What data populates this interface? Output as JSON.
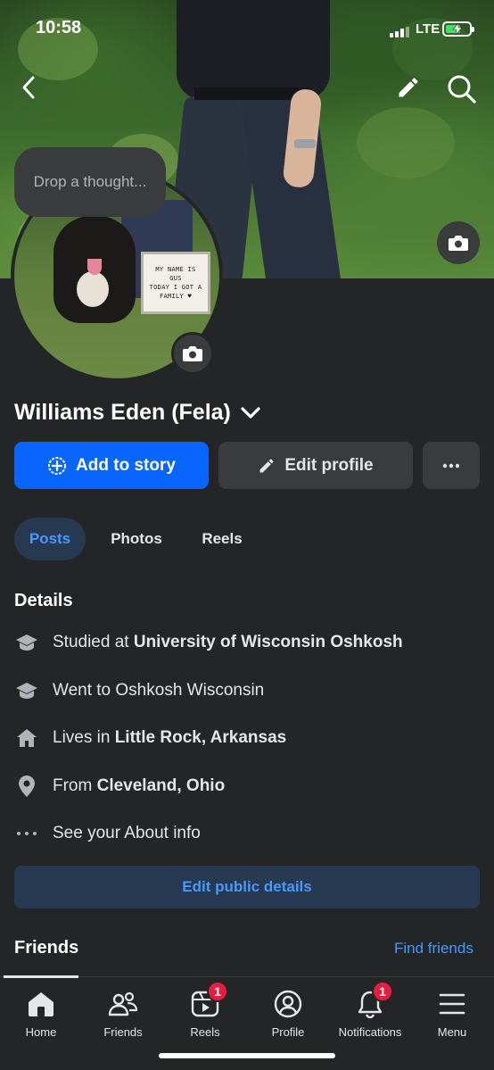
{
  "status_bar": {
    "time": "10:58",
    "network": "LTE",
    "battery_percent": 65
  },
  "header": {
    "back_icon": "chevron-left-icon",
    "edit_icon": "pencil-icon",
    "search_icon": "search-icon",
    "cover_camera_icon": "camera-icon"
  },
  "avatar": {
    "sign_lines": [
      "MY NAME IS",
      "GUS",
      "TODAY I GOT A",
      "FAMILY ♥"
    ],
    "camera_icon": "camera-icon"
  },
  "thought_bubble": {
    "placeholder": "Drop a thought..."
  },
  "profile": {
    "name": "Williams Eden (Fela)"
  },
  "actions": {
    "add_to_story": "Add to story",
    "edit_profile": "Edit profile",
    "more": "•••"
  },
  "tabs": [
    {
      "label": "Posts",
      "active": true
    },
    {
      "label": "Photos",
      "active": false
    },
    {
      "label": "Reels",
      "active": false
    }
  ],
  "details": {
    "title": "Details",
    "items": [
      {
        "icon": "graduation-cap-icon",
        "prefix": "Studied at ",
        "bold": "University of Wisconsin Oshkosh"
      },
      {
        "icon": "graduation-cap-icon",
        "prefix": "Went to Oshkosh Wisconsin",
        "bold": ""
      },
      {
        "icon": "house-icon",
        "prefix": "Lives in ",
        "bold": "Little Rock, Arkansas"
      },
      {
        "icon": "location-pin-icon",
        "prefix": "From ",
        "bold": "Cleveland, Ohio"
      },
      {
        "icon": "ellipsis-icon",
        "prefix": "See your About info",
        "bold": ""
      }
    ],
    "edit_public_details": "Edit public details"
  },
  "friends": {
    "title": "Friends",
    "find_friends": "Find friends"
  },
  "bottom_nav": [
    {
      "label": "Home",
      "icon": "home-icon",
      "badge": ""
    },
    {
      "label": "Friends",
      "icon": "friends-icon",
      "badge": ""
    },
    {
      "label": "Reels",
      "icon": "reels-icon",
      "badge": "1"
    },
    {
      "label": "Profile",
      "icon": "profile-icon",
      "badge": ""
    },
    {
      "label": "Notifications",
      "icon": "bell-icon",
      "badge": "1"
    },
    {
      "label": "Menu",
      "icon": "menu-icon",
      "badge": ""
    }
  ],
  "colors": {
    "accent": "#0866ff",
    "link": "#4599ff",
    "background": "#242526",
    "surface": "#3a3b3c",
    "badge": "#e41e3f"
  }
}
